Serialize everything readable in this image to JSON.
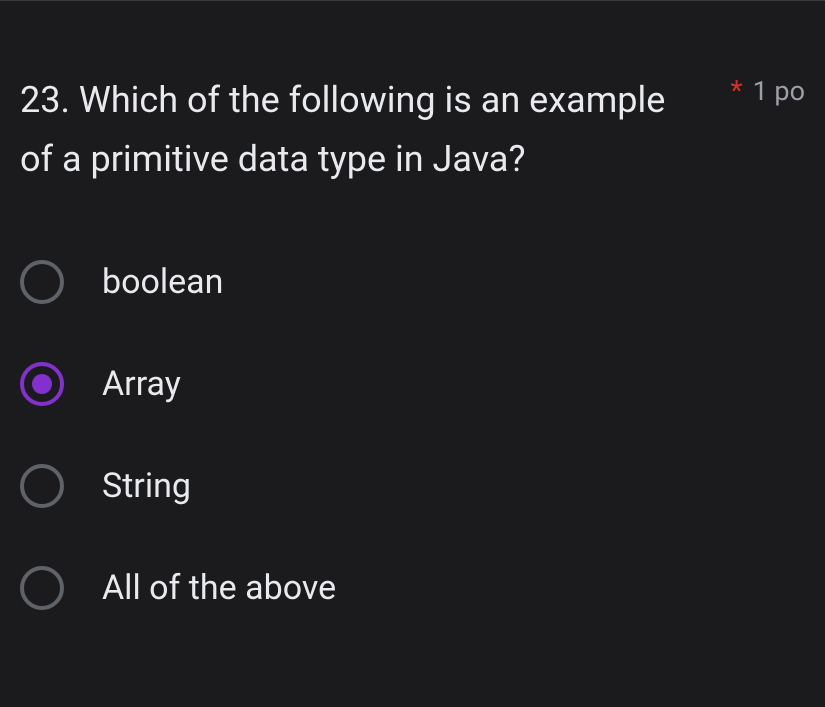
{
  "question": {
    "number": "23.",
    "text": "23. Which of the following is an example of a primitive data type in Java?",
    "required_marker": "*",
    "points_label": "1 po"
  },
  "options": [
    {
      "label": "boolean",
      "selected": false
    },
    {
      "label": "Array",
      "selected": true
    },
    {
      "label": "String",
      "selected": false
    },
    {
      "label": "All of the above",
      "selected": false
    }
  ]
}
